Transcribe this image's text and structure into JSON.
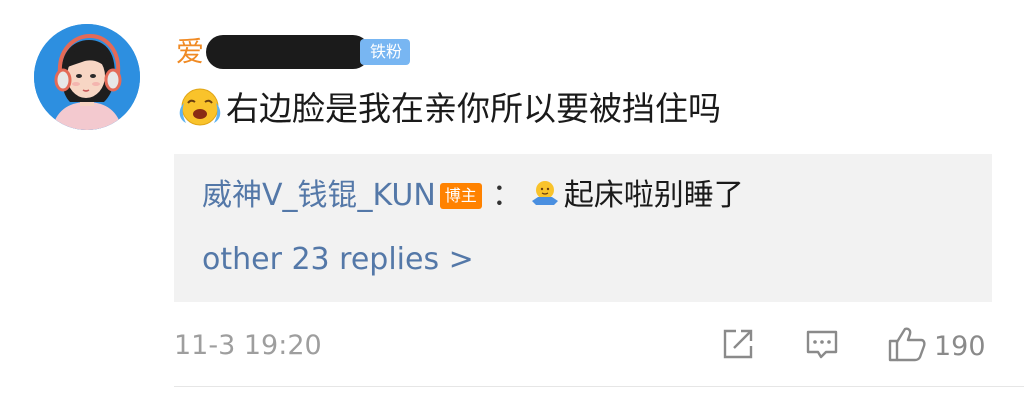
{
  "comment": {
    "username_visible": "爱",
    "fan_badge": "铁粉",
    "text": "右边脸是我在亲你所以要被挡住吗",
    "emoji": "crying-laughing-emoji",
    "timestamp": "11-3 19:20",
    "like_count": "190"
  },
  "reply": {
    "username": "威神V_钱锟_KUN",
    "author_badge": "博主",
    "colon": "：",
    "emoji": "shrug-emoji",
    "text": "起床啦别睡了",
    "more_replies": "other 23 replies >"
  },
  "icons": {
    "share": "share-icon",
    "comment": "comment-icon",
    "like": "thumbs-up-icon"
  },
  "colors": {
    "username": "#f08a24",
    "link_blue": "#5478a8",
    "fan_badge_bg": "#78b6f2",
    "author_badge_bg": "#ff8200",
    "reply_bg": "#f2f2f2",
    "meta_gray": "#9e9e9e",
    "avatar_bg": "#2d8fe0"
  }
}
